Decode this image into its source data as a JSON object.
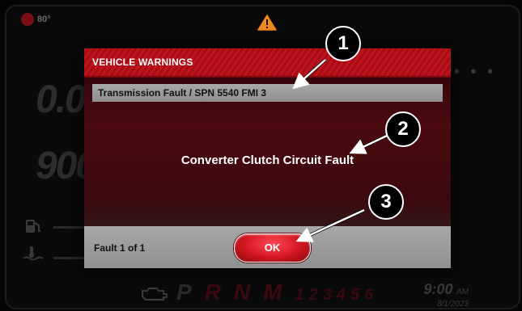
{
  "status": {
    "temperature": "80°",
    "warning_icon": "warning-triangle-icon"
  },
  "dashboard": {
    "speed_digits": "0.0",
    "rpm_digits": "900",
    "gears": [
      "P",
      "R",
      "N",
      "M",
      "1",
      "2",
      "3",
      "4",
      "5",
      "6"
    ],
    "clock_time": "9:00",
    "clock_ampm": "AM",
    "clock_date": "8/1/2023"
  },
  "dialog": {
    "title": "VEHICLE WARNINGS",
    "fault_code": "Transmission Fault / SPN 5540 FMI 3",
    "fault_description": "Converter Clutch Circuit Fault",
    "fault_count": "Fault 1 of 1",
    "ok_label": "OK"
  },
  "callouts": {
    "c1": "1",
    "c2": "2",
    "c3": "3"
  },
  "colors": {
    "accent_red": "#c2121c",
    "warning_orange": "#f08a1c"
  }
}
